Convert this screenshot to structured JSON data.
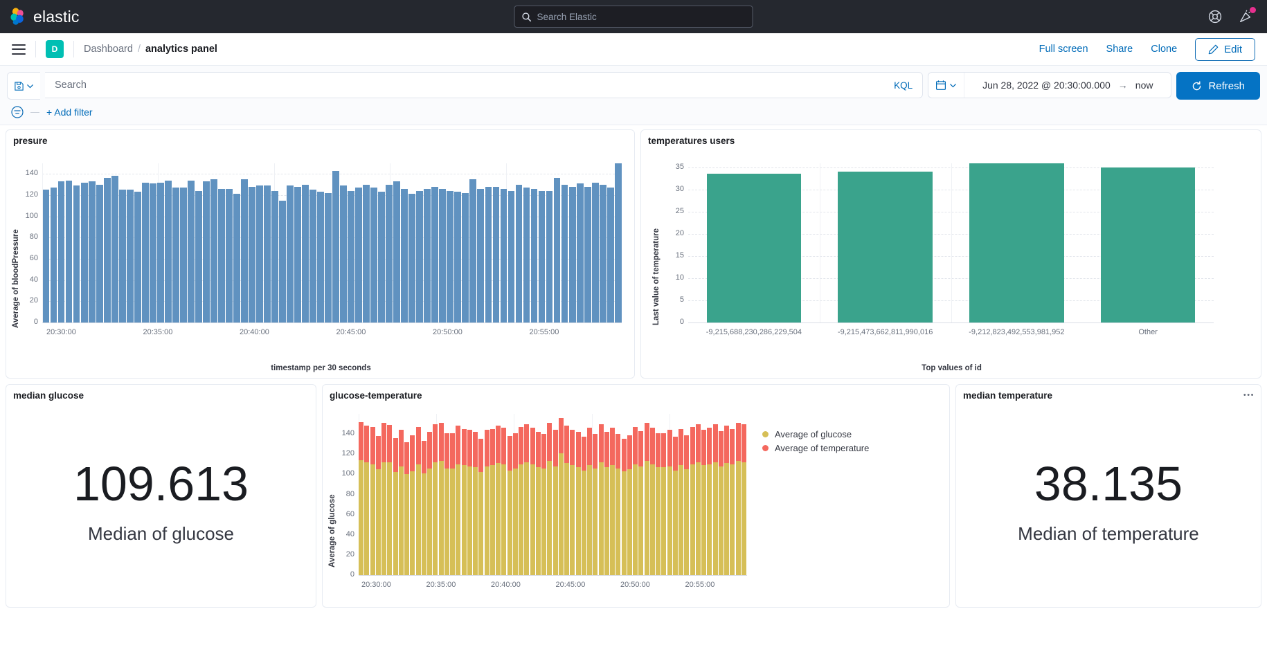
{
  "topbar": {
    "brand": "elastic",
    "search_placeholder": "Search Elastic",
    "search_value": "",
    "icons": [
      "help-icon",
      "announcement-icon"
    ]
  },
  "breadcrumb": {
    "space_initial": "D",
    "parent": "Dashboard",
    "separator": "/",
    "current": "analytics panel",
    "actions": {
      "fullscreen": "Full screen",
      "share": "Share",
      "clone": "Clone",
      "edit": "Edit"
    }
  },
  "query": {
    "search_placeholder": "Search",
    "search_value": "",
    "language": "KQL",
    "date_start": "Jun 28, 2022 @ 20:30:00.000",
    "date_arrow": "→",
    "date_end": "now",
    "refresh": "Refresh",
    "add_filter": "+ Add filter"
  },
  "panels": {
    "presure": {
      "title": "presure"
    },
    "temperatures_users": {
      "title": "temperatures users"
    },
    "median_glucose": {
      "title": "median glucose",
      "value": "109.613",
      "label": "Median of glucose"
    },
    "glucose_temperature": {
      "title": "glucose-temperature"
    },
    "median_temperature": {
      "title": "median temperature",
      "value": "38.135",
      "label": "Median of temperature",
      "menu": "•••"
    }
  },
  "chart_data": [
    {
      "id": "presure",
      "type": "bar",
      "title": "presure",
      "xlabel": "timestamp per 30 seconds",
      "ylabel": "Average of bloodPressure",
      "ylim": [
        0,
        150
      ],
      "yticks": [
        0,
        20,
        40,
        60,
        80,
        100,
        120,
        140
      ],
      "xticks": [
        "20:30:00",
        "20:35:00",
        "20:40:00",
        "20:45:00",
        "20:50:00",
        "20:55:00"
      ],
      "color": "#6092c0",
      "grid": true,
      "values": [
        125,
        127,
        133,
        134,
        129,
        132,
        133,
        130,
        136,
        138,
        125,
        125,
        123,
        132,
        131,
        132,
        134,
        127,
        127,
        134,
        124,
        133,
        135,
        126,
        126,
        121,
        135,
        128,
        129,
        129,
        124,
        115,
        129,
        128,
        130,
        125,
        123,
        122,
        143,
        129,
        124,
        127,
        130,
        127,
        123,
        130,
        133,
        126,
        121,
        124,
        126,
        128,
        126,
        124,
        123,
        122,
        135,
        126,
        128,
        128,
        126,
        124,
        130,
        127,
        126,
        124,
        124,
        136,
        130,
        128,
        131,
        128,
        132,
        130,
        127,
        150
      ]
    },
    {
      "id": "temperatures_users",
      "type": "bar",
      "title": "temperatures users",
      "xlabel": "Top values of id",
      "ylabel": "Last value of temperature",
      "ylim": [
        0,
        36
      ],
      "yticks": [
        0,
        5,
        10,
        15,
        20,
        25,
        30,
        35
      ],
      "categories": [
        "-9,215,688,230,286,229,504",
        "-9,215,473,662,811,990,016",
        "-9,212,823,492,553,981,952",
        "Other"
      ],
      "values": [
        33.7,
        34.1,
        36.0,
        35.0
      ],
      "color": "#3aa38c",
      "grid": true
    },
    {
      "id": "glucose_temperature",
      "type": "bar",
      "title": "glucose-temperature",
      "stacked": true,
      "xlabel": "",
      "ylabel": "Average of glucose",
      "ylim": [
        0,
        160
      ],
      "yticks": [
        0,
        20,
        40,
        60,
        80,
        100,
        120,
        140
      ],
      "xticks": [
        "20:30:00",
        "20:35:00",
        "20:40:00",
        "20:45:00",
        "20:50:00",
        "20:55:00"
      ],
      "legend": [
        {
          "name": "Average of glucose",
          "color": "#d6bf57"
        },
        {
          "name": "Average of temperature",
          "color": "#f4685e"
        }
      ],
      "series": [
        {
          "name": "Average of glucose",
          "color": "#d6bf57",
          "values": [
            114,
            112,
            110,
            105,
            112,
            112,
            102,
            108,
            100,
            103,
            110,
            101,
            106,
            112,
            113,
            106,
            106,
            110,
            109,
            108,
            107,
            102,
            108,
            109,
            111,
            110,
            104,
            106,
            110,
            112,
            110,
            107,
            106,
            113,
            108,
            121,
            111,
            109,
            107,
            104,
            109,
            106,
            112,
            107,
            109,
            106,
            103,
            105,
            110,
            108,
            113,
            110,
            107,
            107,
            108,
            104,
            109,
            105,
            110,
            112,
            109,
            110,
            112,
            108,
            111,
            110,
            113,
            112
          ]
        },
        {
          "name": "Average of temperature",
          "color": "#f4685e",
          "values": [
            38,
            36,
            37,
            33,
            39,
            37,
            34,
            36,
            32,
            36,
            37,
            32,
            36,
            38,
            38,
            35,
            35,
            38,
            36,
            36,
            35,
            33,
            36,
            36,
            37,
            36,
            34,
            35,
            37,
            38,
            36,
            35,
            34,
            38,
            36,
            35,
            37,
            35,
            35,
            33,
            37,
            34,
            38,
            35,
            37,
            34,
            32,
            34,
            37,
            35,
            38,
            36,
            34,
            34,
            36,
            33,
            36,
            34,
            37,
            38,
            35,
            36,
            38,
            35,
            37,
            35,
            38,
            38
          ]
        }
      ]
    }
  ]
}
